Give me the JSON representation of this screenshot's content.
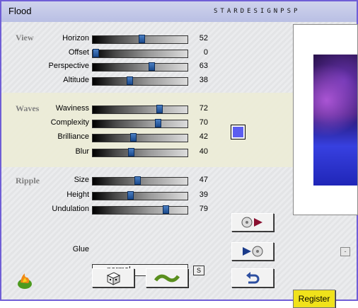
{
  "window": {
    "title": "Flood",
    "brand": "STARDESIGNPSP"
  },
  "groups": {
    "view": "View",
    "waves": "Waves",
    "ripple": "Ripple"
  },
  "params": [
    {
      "label": "Horizon",
      "value": "52",
      "level": 52
    },
    {
      "label": "Offset",
      "value": "0",
      "level": 0
    },
    {
      "label": "Perspective",
      "value": "63",
      "level": 63
    },
    {
      "label": "Altitude",
      "value": "38",
      "level": 38
    },
    {
      "label": "Waviness",
      "value": "72",
      "level": 72
    },
    {
      "label": "Complexity",
      "value": "70",
      "level": 70
    },
    {
      "label": "Brilliance",
      "value": "42",
      "level": 42
    },
    {
      "label": "Blur",
      "value": "40",
      "level": 40
    },
    {
      "label": "Size",
      "value": "47",
      "level": 47
    },
    {
      "label": "Height",
      "value": "39",
      "level": 39
    },
    {
      "label": "Undulation",
      "value": "79",
      "level": 79
    }
  ],
  "color_swatch": "#5b5df0",
  "glue": {
    "label": "Glue",
    "value": "normal",
    "dropdown_glyph": "S"
  },
  "buttons": {
    "register": "Register",
    "minimize_glyph": "-"
  },
  "icons": {
    "load": "disc-play-icon",
    "save": "play-disc-icon",
    "random": "dice-icon",
    "reset": "wave-icon",
    "undo": "undo-arrow-icon",
    "logo": "flame-logo-icon"
  }
}
